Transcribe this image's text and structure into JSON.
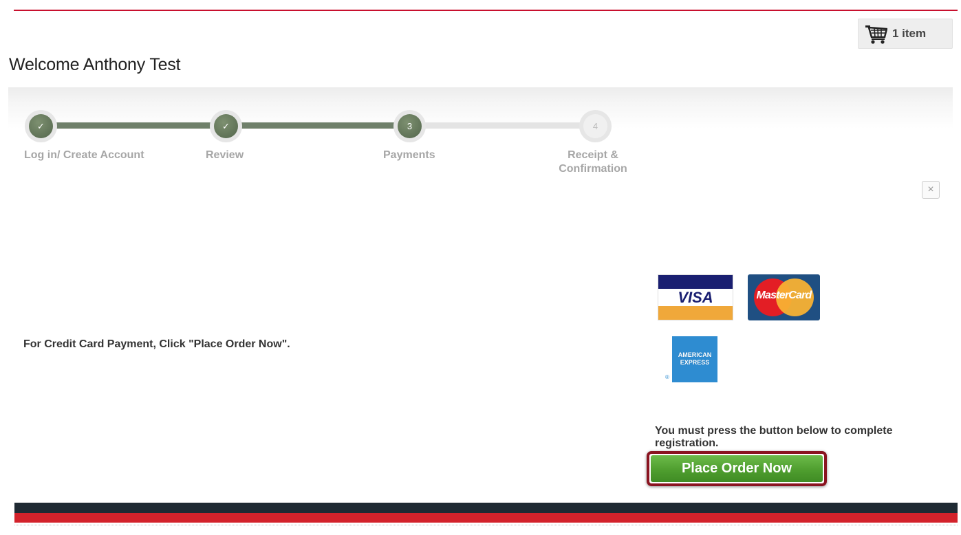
{
  "cart": {
    "icon": "shopping-cart-icon",
    "label": "1 item"
  },
  "welcome": "Welcome Anthony Test",
  "steps": [
    {
      "number": "✓",
      "label": "Log in/ Create Account",
      "status": "complete"
    },
    {
      "number": "✓",
      "label": "Review",
      "status": "complete"
    },
    {
      "number": "3",
      "label": "Payments",
      "status": "current"
    },
    {
      "number": "4",
      "label_line1": "Receipt &",
      "label_line2": "Confirmation",
      "status": "pending"
    }
  ],
  "close": {
    "icon": "close-icon",
    "glyph": "×"
  },
  "payment": {
    "instruction": "For Credit Card Payment, Click \"Place Order Now\".",
    "cards": {
      "visa": "VISA",
      "mastercard": "MasterCard",
      "amex_line1": "AMERICAN",
      "amex_line2": "EXPRESS",
      "amex_reg": "®"
    },
    "notice": "You must press the button below to complete registration.",
    "button_label": "Place Order Now"
  },
  "colors": {
    "brand_red": "#c8102e",
    "step_green": "#5f7258",
    "button_green": "#4f9e2f",
    "highlight": "#8a1420",
    "footer_dark": "#1f2a33"
  }
}
